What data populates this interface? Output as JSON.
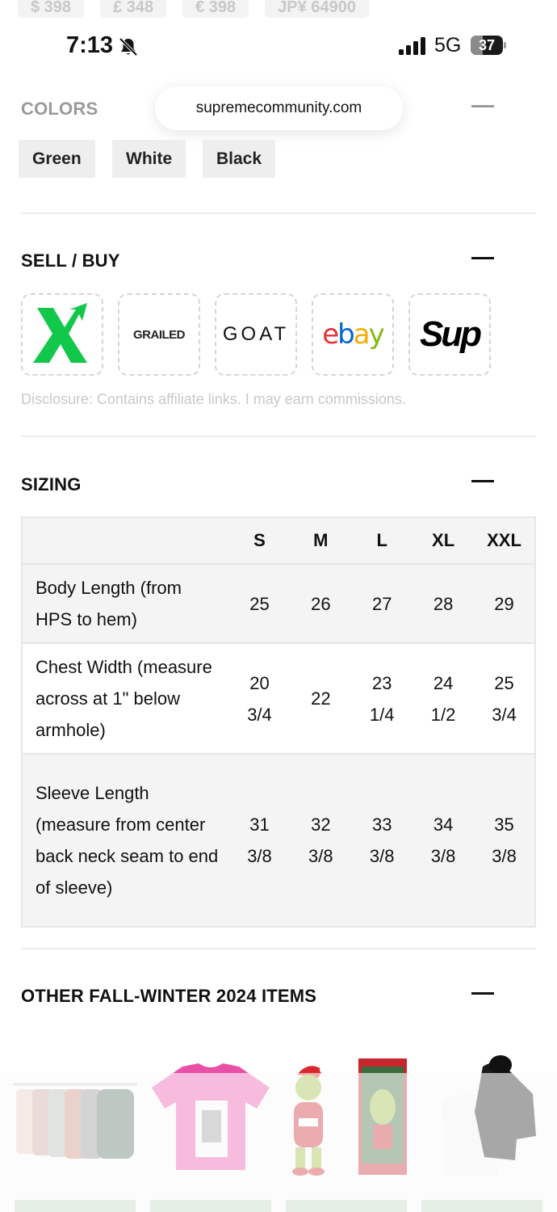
{
  "prices": [
    "$ 398",
    "£ 348",
    "€ 398",
    "JP¥ 64900"
  ],
  "status_bar": {
    "time": "7:13",
    "network": "5G",
    "battery": "37",
    "battery_level": 0.37,
    "silent_icon": "bell-slash-icon",
    "signal_icon": "cellular-signal-icon"
  },
  "browser": {
    "url": "supremecommunity.com"
  },
  "colors_section": {
    "title": "COLORS",
    "options": [
      "Green",
      "White",
      "Black"
    ]
  },
  "sell_buy": {
    "title": "SELL / BUY",
    "retailers": [
      {
        "name": "stockx",
        "icon": "stockx-logo"
      },
      {
        "name": "GRAILED"
      },
      {
        "name": "GOAT"
      },
      {
        "name": "ebay"
      },
      {
        "name": "Sup"
      }
    ],
    "disclosure": "Disclosure: Contains affiliate links. I may earn commissions."
  },
  "sizing": {
    "title": "SIZING",
    "sizes": [
      "S",
      "M",
      "L",
      "XL",
      "XXL"
    ],
    "rows": [
      {
        "label": "Body Length (from HPS to hem)",
        "values": [
          "25",
          "26",
          "27",
          "28",
          "29"
        ]
      },
      {
        "label": "Chest Width (measure across at 1\" below armhole)",
        "values": [
          "20 3/4",
          "22",
          "23 1/4",
          "24 1/2",
          "25 3/4"
        ]
      },
      {
        "label": "Sleeve Length (measure from center back neck seam to end of sleeve)",
        "values": [
          "31 3/8",
          "32 3/8",
          "33 3/8",
          "34 3/8",
          "35 3/8"
        ]
      }
    ]
  },
  "other_items": {
    "title": "OTHER FALL-WINTER 2024 ITEMS",
    "items": [
      {
        "icon": "jackets-rack-thumbnail"
      },
      {
        "icon": "pink-tshirt-thumbnail"
      },
      {
        "icon": "grinch-figure-thumbnail"
      },
      {
        "icon": "grinch-box-thumbnail"
      },
      {
        "icon": "hoodie-thumbnail"
      }
    ]
  },
  "colors": {
    "accent_green": "#12c84b",
    "ebay_red": "#e53238",
    "ebay_blue": "#0064d2",
    "ebay_yellow": "#f5af02",
    "ebay_green": "#86b817"
  }
}
